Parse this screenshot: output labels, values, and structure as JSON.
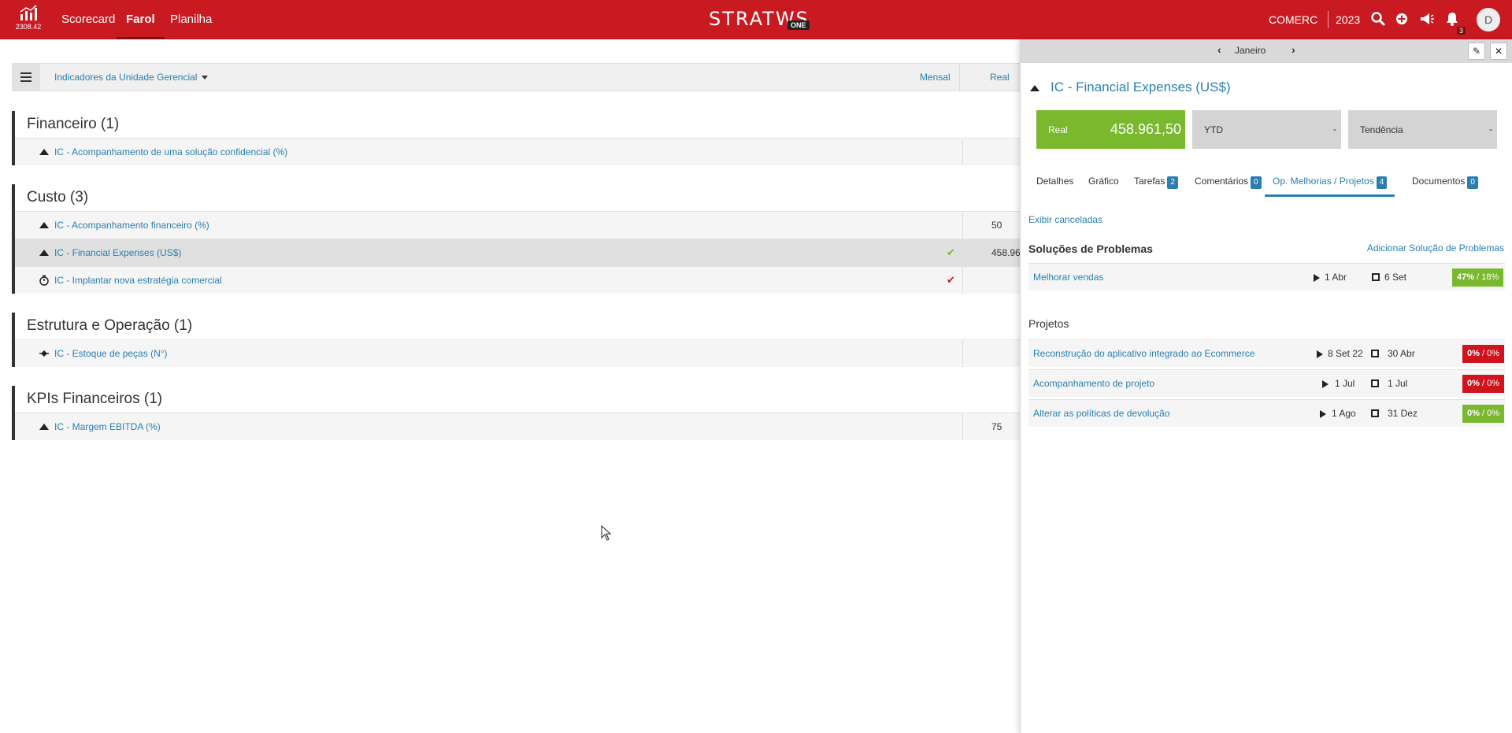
{
  "topbar": {
    "home_version": "2308.42",
    "nav": {
      "scorecard": "Scorecard",
      "farol": "Farol",
      "planilha": "Planilha"
    },
    "logo_word": "STRATWS",
    "logo_badge": "ONE",
    "organization": "COMERC",
    "year": "2023",
    "notifications_count": "3",
    "avatar_initial": "D",
    "accent_color": "#c91a22"
  },
  "toolbar": {
    "filter_label": "Indicadores da Unidade Gerencial",
    "col_period": "Mensal",
    "col_real": "Real"
  },
  "groups": [
    {
      "title": "Financeiro (1)",
      "rows": [
        {
          "name": "IC - Acompanhamento de uma solução confidencial (%)",
          "value": "",
          "icon": "triangle-up-icon"
        }
      ]
    },
    {
      "title": "Custo (3)",
      "rows": [
        {
          "name": "IC - Acompanhamento financeiro (%)",
          "value": "50",
          "icon": "triangle-up-icon"
        },
        {
          "name": "IC - Financial Expenses (US$)",
          "value": "458.96",
          "status": "✔",
          "status_color": "#7ab82e",
          "icon": "triangle-up-icon"
        },
        {
          "name": "IC - Implantar nova estratégia comercial",
          "value": "",
          "status": "✔",
          "status_color": "#d0141e",
          "icon": "stopwatch-icon"
        }
      ]
    },
    {
      "title": "Estrutura e Operação (1)",
      "rows": [
        {
          "name": "IC - Estoque de peças (N°)",
          "value": "",
          "icon": "diamond-icon"
        }
      ]
    },
    {
      "title": "KPIs Financeiros (1)",
      "rows": [
        {
          "name": "IC - Margem EBITDA (%)",
          "value": "75",
          "icon": "triangle-up-icon"
        }
      ]
    }
  ],
  "panel": {
    "month": "Janeiro",
    "indicator_title": "IC - Financial Expenses (US$)",
    "kpis": {
      "real_label": "Real",
      "real_value": "458.961,50",
      "ytd_label": "YTD",
      "ytd_value": "-",
      "trend_label": "Tendência",
      "trend_value": "-"
    },
    "tabs": [
      {
        "label": "Detalhes",
        "badge": ""
      },
      {
        "label": "Gráfico",
        "badge": ""
      },
      {
        "label": "Tarefas",
        "badge": "2"
      },
      {
        "label": "Comentários",
        "badge": "0"
      },
      {
        "label": "Op. Melhorias / Projetos",
        "badge": "4"
      },
      {
        "label": "Documentos",
        "badge": "0"
      }
    ],
    "show_cancelled": "Exibir canceladas",
    "solutions_title": "Soluções de Problemas",
    "add_solution": "Adicionar Solução de Problemas",
    "solutions": [
      {
        "name": "Melhorar vendas",
        "start": "1 Abr",
        "end": "6 Set",
        "pct_main": "47%",
        "pct_sub": "/ 18%",
        "color": "#7ab82e"
      }
    ],
    "projects_title": "Projetos",
    "projects": [
      {
        "name": "Reconstrução do aplicativo integrado ao Ecommerce",
        "start": "8 Set 22",
        "end": "30 Abr",
        "pct_main": "0%",
        "pct_sub": "/ 0%",
        "color": "#d0141e"
      },
      {
        "name": "Acompanhamento de projeto",
        "start": "1 Jul",
        "end": "1 Jul",
        "pct_main": "0%",
        "pct_sub": "/ 0%",
        "color": "#d0141e"
      },
      {
        "name": "Alterar as políticas de devolução",
        "start": "1 Ago",
        "end": "31 Dez",
        "pct_main": "0%",
        "pct_sub": "/ 0%",
        "color": "#7ab82e"
      }
    ]
  }
}
